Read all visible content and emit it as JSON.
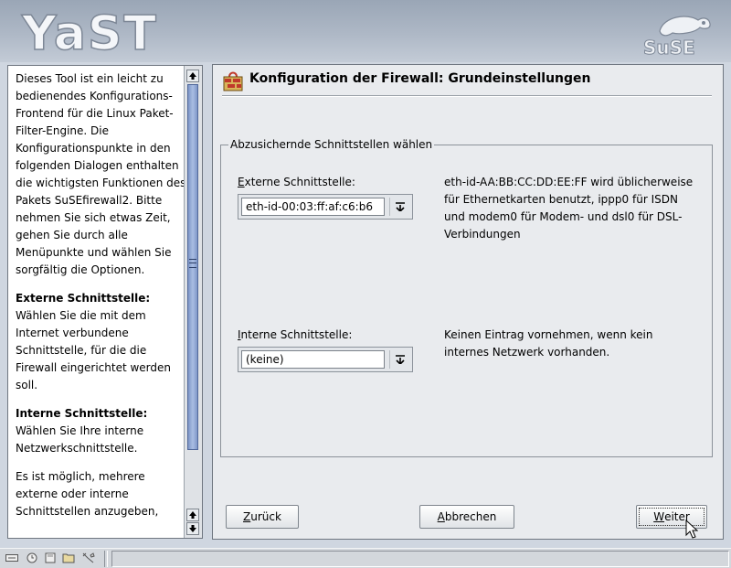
{
  "header": {
    "yast_logo_text": "YaST",
    "suse_logo_text": "SuSE"
  },
  "help": {
    "paragraphs": [
      "Dieses Tool ist ein leicht zu bedienendes Konfigurations-Frontend für die Linux Paket-Filter-Engine. Die Konfigurationspunkte in den folgenden Dialogen enthalten die wichtigsten Funktionen des Pakets SuSEfirewall2. Bitte nehmen Sie sich etwas Zeit, gehen Sie durch alle Menüpunkte und wählen Sie sorgfältig die Optionen.",
      "Wählen Sie die mit dem Internet verbundene Schnittstelle, für die die Firewall eingerichtet werden soll.",
      "Wählen Sie Ihre interne Netzwerkschnittstelle.",
      "Es ist möglich, mehrere externe oder interne Schnittstellen anzugeben,"
    ],
    "heading_external": "Externe Schnittstelle:",
    "heading_internal": "Interne Schnittstelle:"
  },
  "dialog": {
    "title": "Konfiguration der Firewall: Grundeinstellungen",
    "groupbox_label": "Abzusichernde Schnittstellen wählen",
    "external": {
      "label_first": "E",
      "label_rest": "xterne Schnittstelle:",
      "value": "eth-id-00:03:ff:af:c6:b6",
      "description": "eth-id-AA:BB:CC:DD:EE:FF wird üblicherweise für Ethernetkarten benutzt, ippp0 für ISDN und modem0 für Modem- und dsl0 für DSL-Verbindungen"
    },
    "internal": {
      "label_first": "I",
      "label_rest": "nterne Schnittstelle:",
      "value": "(keine)",
      "description": "Keinen Eintrag vornehmen, wenn kein internes Netzwerk vorhanden."
    }
  },
  "buttons": {
    "back_first": "Z",
    "back_rest": "urück",
    "abort_first": "A",
    "abort_rest": "bbrechen",
    "next_first": "W",
    "next_rest": "eiter"
  },
  "colors": {
    "header_bg": "#aeb8c6",
    "panel_bg": "#e9ebee",
    "scrollbar_thumb": "#8fa6d4"
  },
  "icons": {
    "scroll_up": "arrow-up-icon",
    "scroll_down": "arrow-down-icon",
    "combo": "chevron-down-icon",
    "title": "firewall-icon"
  }
}
